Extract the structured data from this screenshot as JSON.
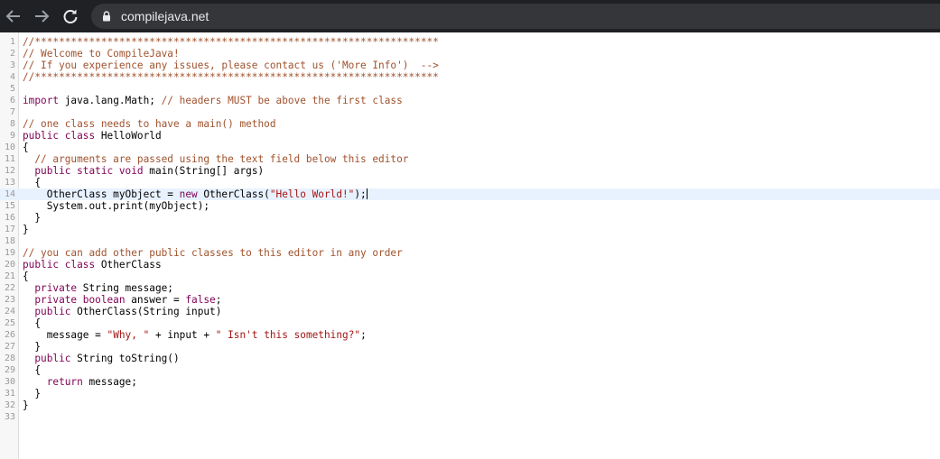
{
  "browser": {
    "url": "compilejava.net",
    "colors": {
      "chrome_bg": "#202124",
      "url_bar_bg": "#35363a",
      "url_text": "#e8eaed"
    },
    "icons": [
      "back-arrow-icon",
      "forward-arrow-icon",
      "reload-icon",
      "lock-icon"
    ]
  },
  "editor": {
    "colors": {
      "comment": "#a0522d",
      "keyword": "#7f0055",
      "string": "#a31515",
      "active_line": "#e8f2ff"
    },
    "active_line": 14,
    "lines": [
      {
        "n": "1",
        "parts": [
          [
            "c",
            "//*******************************************************************"
          ]
        ]
      },
      {
        "n": "2",
        "parts": [
          [
            "c",
            "// Welcome to CompileJava!"
          ]
        ]
      },
      {
        "n": "3",
        "parts": [
          [
            "c",
            "// If you experience any issues, please contact us ('More Info')  -->"
          ]
        ]
      },
      {
        "n": "4",
        "parts": [
          [
            "c",
            "//*******************************************************************"
          ]
        ]
      },
      {
        "n": "5",
        "parts": []
      },
      {
        "n": "6",
        "parts": [
          [
            "k",
            "import"
          ],
          [
            "p",
            " java.lang.Math; "
          ],
          [
            "c",
            "// headers MUST be above the first class"
          ]
        ]
      },
      {
        "n": "7",
        "parts": []
      },
      {
        "n": "8",
        "parts": [
          [
            "c",
            "// one class needs to have a main() method"
          ]
        ]
      },
      {
        "n": "9",
        "parts": [
          [
            "k",
            "public class"
          ],
          [
            "p",
            " HelloWorld"
          ]
        ]
      },
      {
        "n": "10",
        "parts": [
          [
            "p",
            "{"
          ]
        ]
      },
      {
        "n": "11",
        "parts": [
          [
            "p",
            "  "
          ],
          [
            "c",
            "// arguments are passed using the text field below this editor"
          ]
        ]
      },
      {
        "n": "12",
        "parts": [
          [
            "p",
            "  "
          ],
          [
            "k",
            "public static void"
          ],
          [
            "p",
            " main(String[] args)"
          ]
        ]
      },
      {
        "n": "13",
        "parts": [
          [
            "p",
            "  {"
          ]
        ]
      },
      {
        "n": "14",
        "parts": [
          [
            "p",
            "    OtherClass myObject = "
          ],
          [
            "k",
            "new"
          ],
          [
            "p",
            " OtherClass("
          ],
          [
            "s",
            "\"Hello World!\""
          ],
          [
            "p",
            ");"
          ]
        ]
      },
      {
        "n": "15",
        "parts": [
          [
            "p",
            "    System.out.print(myObject);"
          ]
        ]
      },
      {
        "n": "16",
        "parts": [
          [
            "p",
            "  }"
          ]
        ]
      },
      {
        "n": "17",
        "parts": [
          [
            "p",
            "}"
          ]
        ]
      },
      {
        "n": "18",
        "parts": []
      },
      {
        "n": "19",
        "parts": [
          [
            "c",
            "// you can add other public classes to this editor in any order"
          ]
        ]
      },
      {
        "n": "20",
        "parts": [
          [
            "k",
            "public class"
          ],
          [
            "p",
            " OtherClass"
          ]
        ]
      },
      {
        "n": "21",
        "parts": [
          [
            "p",
            "{"
          ]
        ]
      },
      {
        "n": "22",
        "parts": [
          [
            "p",
            "  "
          ],
          [
            "k",
            "private"
          ],
          [
            "p",
            " String message;"
          ]
        ]
      },
      {
        "n": "23",
        "parts": [
          [
            "p",
            "  "
          ],
          [
            "k",
            "private boolean"
          ],
          [
            "p",
            " answer = "
          ],
          [
            "k",
            "false"
          ],
          [
            "p",
            ";"
          ]
        ]
      },
      {
        "n": "24",
        "parts": [
          [
            "p",
            "  "
          ],
          [
            "k",
            "public"
          ],
          [
            "p",
            " OtherClass(String input)"
          ]
        ]
      },
      {
        "n": "25",
        "parts": [
          [
            "p",
            "  {"
          ]
        ]
      },
      {
        "n": "26",
        "parts": [
          [
            "p",
            "    message = "
          ],
          [
            "s",
            "\"Why, \""
          ],
          [
            "p",
            " + input + "
          ],
          [
            "s",
            "\" Isn't this something?\""
          ],
          [
            "p",
            ";"
          ]
        ]
      },
      {
        "n": "27",
        "parts": [
          [
            "p",
            "  }"
          ]
        ]
      },
      {
        "n": "28",
        "parts": [
          [
            "p",
            "  "
          ],
          [
            "k",
            "public"
          ],
          [
            "p",
            " String toString()"
          ]
        ]
      },
      {
        "n": "29",
        "parts": [
          [
            "p",
            "  {"
          ]
        ]
      },
      {
        "n": "30",
        "parts": [
          [
            "p",
            "    "
          ],
          [
            "k",
            "return"
          ],
          [
            "p",
            " message;"
          ]
        ]
      },
      {
        "n": "31",
        "parts": [
          [
            "p",
            "  }"
          ]
        ]
      },
      {
        "n": "32",
        "parts": [
          [
            "p",
            "}"
          ]
        ]
      },
      {
        "n": "33",
        "parts": []
      }
    ]
  }
}
